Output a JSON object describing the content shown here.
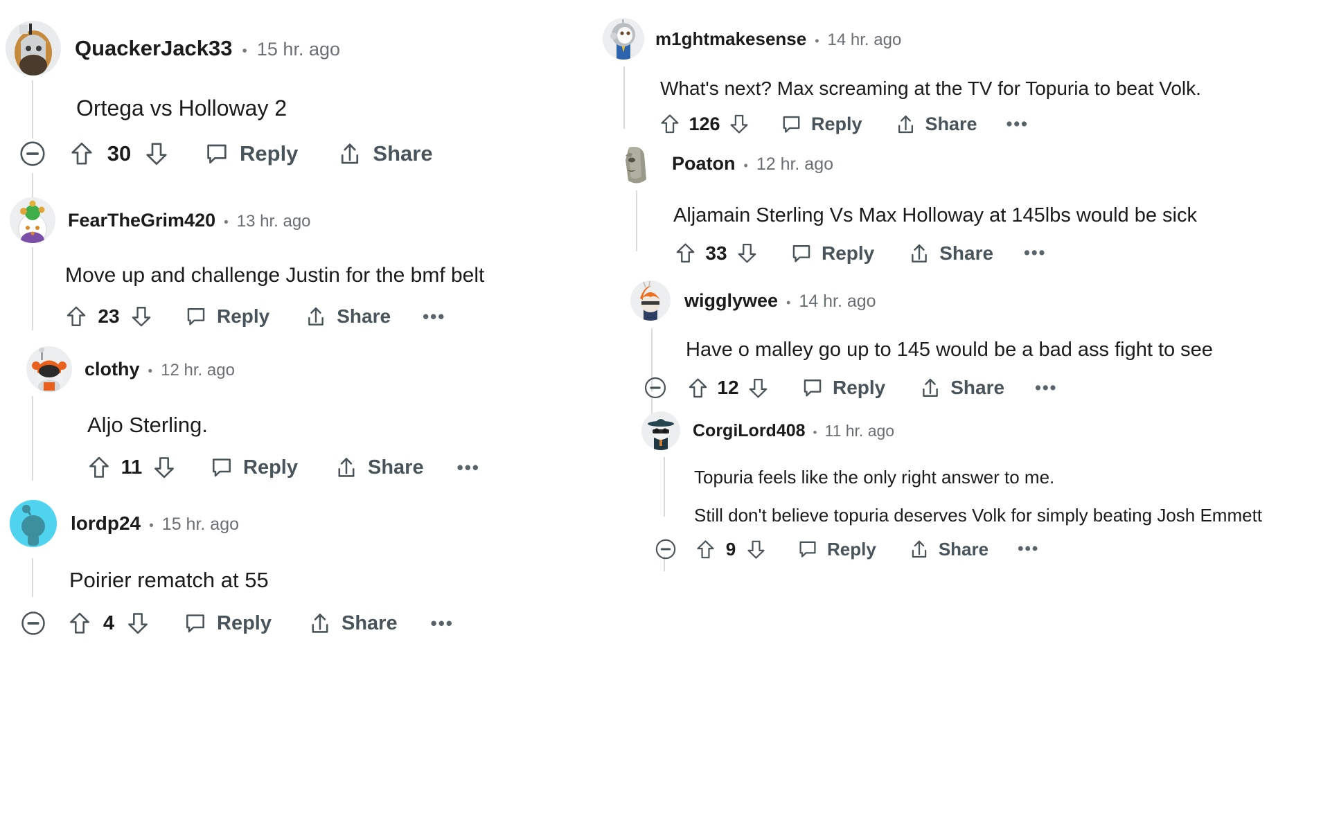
{
  "platform": "reddit-comments",
  "icons": {
    "collapse": "minus-circle-icon",
    "upvote": "upvote-arrow-icon",
    "downvote": "downvote-arrow-icon",
    "reply": "speech-bubble-icon",
    "share": "share-arrow-icon",
    "more": "more-options-icon"
  },
  "labels": {
    "reply": "Reply",
    "share": "Share",
    "more": "•••",
    "separator": "•"
  },
  "colors": {
    "text": "#1b1b1b",
    "meta": "#6a6f73",
    "action": "#48535a",
    "threadline": "#d8dbdd",
    "background": "#ffffff",
    "lordp24_avatar": "#4fd3ee"
  },
  "left_column": [
    {
      "id": "quackerjack33",
      "username": "QuackerJack33",
      "timestamp": "15 hr. ago",
      "body": "Ortega vs Holloway 2",
      "votes": "30",
      "has_collapse": true,
      "has_more": false,
      "avatar": "duck-knight-avatar"
    },
    {
      "id": "fearthegrim420",
      "username": "FearTheGrim420",
      "timestamp": "13 hr. ago",
      "body": "Move up and challenge Justin for the bmf belt",
      "votes": "23",
      "has_collapse": false,
      "has_more": true,
      "avatar": "green-hat-snoo-avatar"
    },
    {
      "id": "clothy",
      "username": "clothy",
      "timestamp": "12 hr. ago",
      "body": "Aljo Sterling.",
      "votes": "11",
      "has_collapse": false,
      "has_more": true,
      "avatar": "orange-helmet-snoo-avatar"
    },
    {
      "id": "lordp24",
      "username": "lordp24",
      "timestamp": "15 hr. ago",
      "body": "Poirier rematch at 55",
      "votes": "4",
      "has_collapse": true,
      "has_more": true,
      "avatar": "cyan-snoo-avatar"
    }
  ],
  "right_column": [
    {
      "id": "m1ghtmakesense",
      "username": "m1ghtmakesense",
      "timestamp": "14 hr. ago",
      "body": "What's next? Max screaming at the TV for Topuria to beat Volk.",
      "votes": "126",
      "has_collapse": false,
      "has_more": true,
      "avatar": "astronaut-snoo-avatar"
    },
    {
      "id": "poaton",
      "username": "Poaton",
      "timestamp": "12 hr. ago",
      "body": "Aljamain Sterling Vs Max Holloway at 145lbs would be sick",
      "votes": "33",
      "has_collapse": false,
      "has_more": true,
      "avatar": "moai-statue-avatar"
    },
    {
      "id": "wigglywee",
      "username": "wigglywee",
      "timestamp": "14 hr. ago",
      "body": "Have o malley go up to 145 would be a bad ass fight to see",
      "votes": "12",
      "has_collapse": true,
      "has_more": true,
      "avatar": "orange-hair-snoo-avatar"
    },
    {
      "id": "corgilord408",
      "username": "CorgiLord408",
      "timestamp": "11 hr. ago",
      "body": "Topuria feels like the only right answer to me.",
      "body2": "Still don't believe topuria deserves Volk for simply beating Josh Emmett",
      "votes": "9",
      "has_collapse": true,
      "has_more": true,
      "avatar": "detective-hat-snoo-avatar"
    }
  ]
}
